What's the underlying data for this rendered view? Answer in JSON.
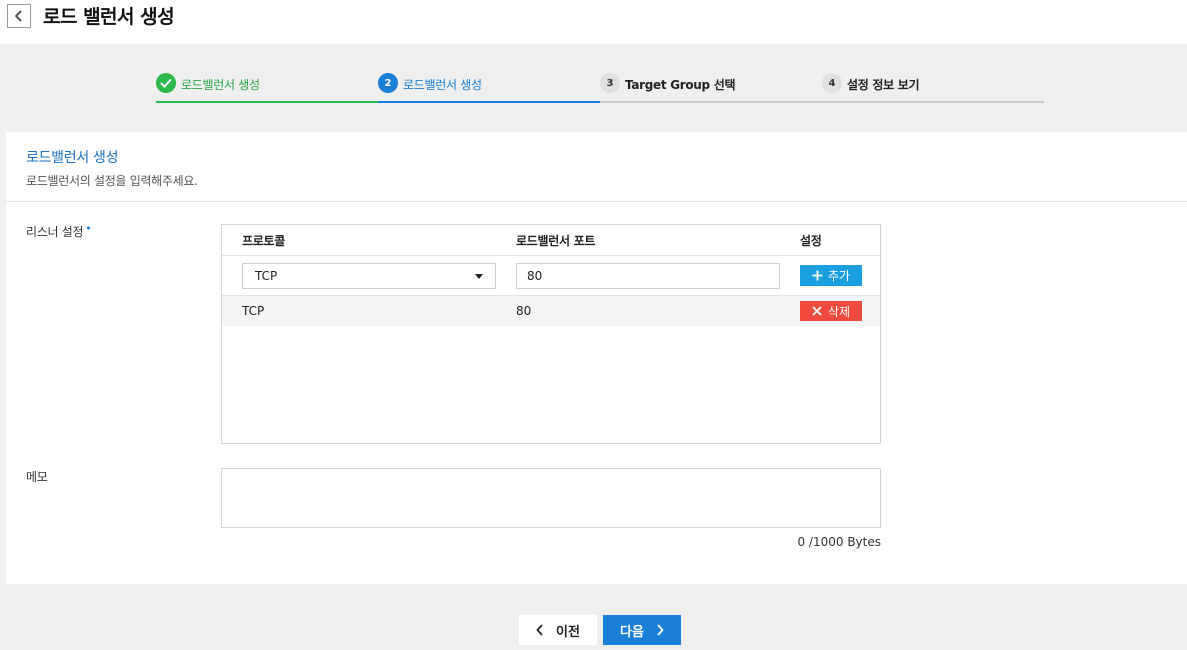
{
  "header": {
    "title": "로드 밸런서 생성",
    "back_icon": "chevron-left-icon"
  },
  "stepper": {
    "steps": [
      {
        "number": "",
        "label": "로드밸런서 생성",
        "state": "done",
        "color": "#2db84b"
      },
      {
        "number": "2",
        "label": "로드밸런서 생성",
        "state": "active",
        "color": "#1a7fd6"
      },
      {
        "number": "3",
        "label": "Target Group 선택",
        "state": "pending"
      },
      {
        "number": "4",
        "label": "설정 정보 보기",
        "state": "pending"
      }
    ]
  },
  "card": {
    "title": "로드밸런서 생성",
    "subtitle": "로드밸런서의 설정을 입력해주세요."
  },
  "listener": {
    "label": "리스너 설정",
    "required_mark": "•",
    "columns": [
      "프로토콜",
      "로드밸런서 포트",
      "설정"
    ],
    "protocol_select": "TCP",
    "port_value": "80",
    "add_label": "추가",
    "rows": [
      {
        "protocol": "TCP",
        "port": "80",
        "delete_label": "삭제"
      }
    ]
  },
  "memo": {
    "label": "메모",
    "value": "",
    "byte_count": "0 /1000 Bytes"
  },
  "footer": {
    "prev_label": "이전",
    "next_label": "다음"
  },
  "colors": {
    "primary": "#1a7fd6",
    "success": "#2db84b",
    "danger": "#f04a3e",
    "add": "#1a9fe0"
  }
}
